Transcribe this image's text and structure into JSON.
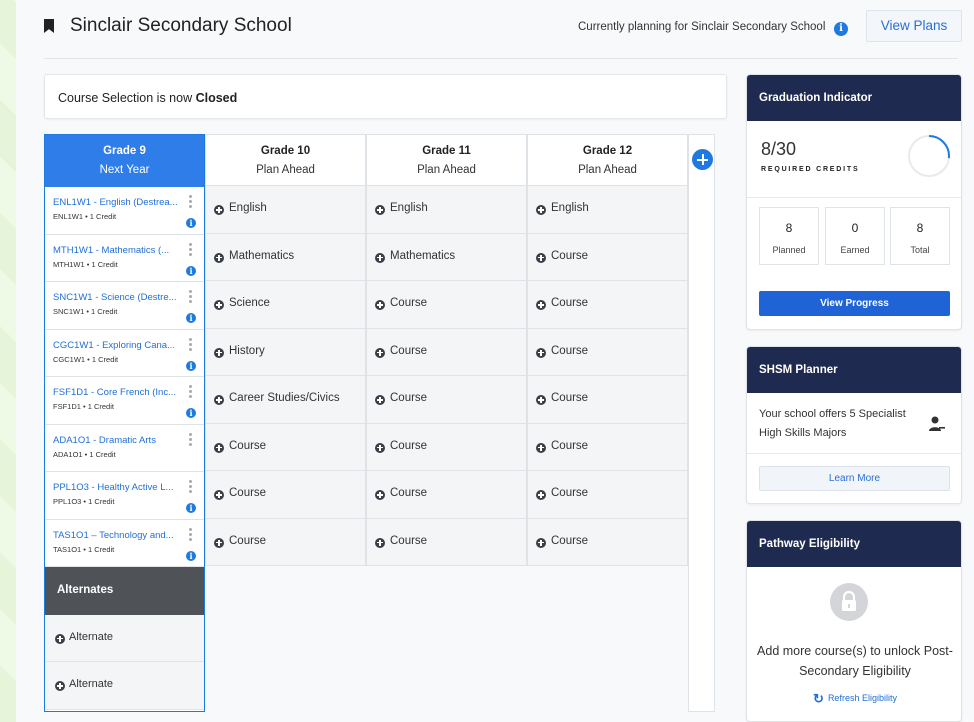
{
  "header": {
    "school_name": "Sinclair Secondary School",
    "planning_text": "Currently planning for Sinclair Secondary School",
    "view_plans_label": "View Plans"
  },
  "notice": {
    "prefix": "Course Selection is now ",
    "status": "Closed"
  },
  "grid": {
    "columns": [
      {
        "grade": "Grade 9",
        "sub": "Next Year"
      },
      {
        "grade": "Grade 10",
        "sub": "Plan Ahead"
      },
      {
        "grade": "Grade 11",
        "sub": "Plan Ahead"
      },
      {
        "grade": "Grade 12",
        "sub": "Plan Ahead"
      }
    ],
    "grade9_courses": [
      {
        "title": "ENL1W1 - English (Destrea...",
        "meta": "ENL1W1 • 1 Credit",
        "has_info": true
      },
      {
        "title": "MTH1W1 - Mathematics (...",
        "meta": "MTH1W1 • 1 Credit",
        "has_info": true
      },
      {
        "title": "SNC1W1 - Science (Destre...",
        "meta": "SNC1W1 • 1 Credit",
        "has_info": true
      },
      {
        "title": "CGC1W1 - Exploring Cana...",
        "meta": "CGC1W1 • 1 Credit",
        "has_info": true
      },
      {
        "title": "FSF1D1 - Core French (Inc...",
        "meta": "FSF1D1 • 1 Credit",
        "has_info": true
      },
      {
        "title": "ADA1O1 - Dramatic Arts",
        "meta": "ADA1O1 • 1 Credit",
        "has_info": false
      },
      {
        "title": "PPL1O3 - Healthy Active L...",
        "meta": "PPL1O3 • 1 Credit",
        "has_info": true
      },
      {
        "title": "TAS1O1 – Technology and...",
        "meta": "TAS1O1 • 1 Credit",
        "has_info": true
      }
    ],
    "grade10_slots": [
      "English",
      "Mathematics",
      "Science",
      "History",
      "Career Studies/Civics",
      "Course",
      "Course",
      "Course"
    ],
    "grade11_slots": [
      "English",
      "Mathematics",
      "Course",
      "Course",
      "Course",
      "Course",
      "Course",
      "Course"
    ],
    "grade12_slots": [
      "English",
      "Course",
      "Course",
      "Course",
      "Course",
      "Course",
      "Course",
      "Course"
    ],
    "alternates_label": "Alternates",
    "alternates": [
      "Alternate",
      "Alternate"
    ],
    "info_glyph": "i"
  },
  "graduation": {
    "title": "Graduation Indicator",
    "credits_text": "8/30",
    "credits_earned": 8,
    "credits_required": 30,
    "subtitle": "REQUIRED CREDITS",
    "stats": [
      {
        "value": "8",
        "label": "Planned"
      },
      {
        "value": "0",
        "label": "Earned"
      },
      {
        "value": "8",
        "label": "Total"
      }
    ],
    "button": "View Progress"
  },
  "shsm": {
    "title": "SHSM Planner",
    "text": "Your school offers 5 Specialist High Skills Majors",
    "button": "Learn More"
  },
  "pathway": {
    "title": "Pathway Eligibility",
    "text": "Add more course(s) to unlock Post-Secondary Eligibility",
    "refresh": "Refresh Eligibility"
  },
  "colors": {
    "accent": "#1f7ae0",
    "card_header": "#1e2a4f",
    "grade9_header": "#2f7de8",
    "alternates_header": "#4f5358"
  }
}
